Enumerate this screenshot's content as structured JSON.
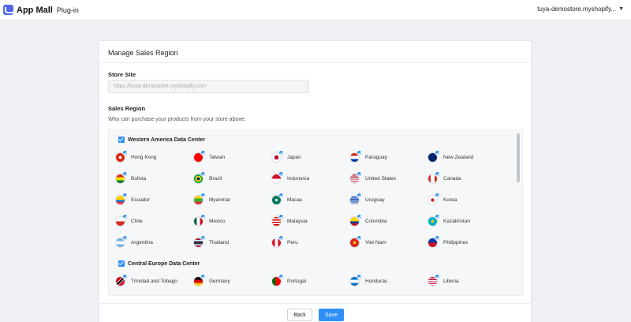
{
  "app": {
    "brand": "App Mall",
    "plugin_label": "Plug-in",
    "store_menu": "tuya-demostore.myshopify..."
  },
  "card": {
    "title": "Manage Sales Region",
    "store_site_label": "Store Site",
    "store_site_placeholder": "https://tuya-demostore.myshopify.com",
    "sales_region_label": "Sales Region",
    "sales_region_hint": "Who can purchase your products from your store above."
  },
  "groups": [
    {
      "title": "Western America Data Center",
      "checked": true,
      "countries": [
        {
          "name": "Hong Kong",
          "flag": "hk-flag"
        },
        {
          "name": "Taiwan",
          "flag": "tw-flag"
        },
        {
          "name": "Japan",
          "flag": "jp-flag"
        },
        {
          "name": "Paraguay",
          "flag": "py-flag"
        },
        {
          "name": "New Zealand",
          "flag": "nz-flag"
        },
        {
          "name": "Bolivia",
          "flag": "bo-flag"
        },
        {
          "name": "Brazil",
          "flag": "br-flag"
        },
        {
          "name": "Indonesia",
          "flag": "id-flag"
        },
        {
          "name": "United States",
          "flag": "us-flag"
        },
        {
          "name": "Canada",
          "flag": "ca-flag"
        },
        {
          "name": "Ecuador",
          "flag": "ec-flag"
        },
        {
          "name": "Myanmar",
          "flag": "mm-flag"
        },
        {
          "name": "Macau",
          "flag": "mo-flag"
        },
        {
          "name": "Uruguay",
          "flag": "uy-flag"
        },
        {
          "name": "Korea",
          "flag": "kr-flag"
        },
        {
          "name": "Chile",
          "flag": "cl-flag"
        },
        {
          "name": "Mexico",
          "flag": "mx-flag"
        },
        {
          "name": "Malaysia",
          "flag": "my-flag"
        },
        {
          "name": "Colombia",
          "flag": "co-flag"
        },
        {
          "name": "Kazakhstan",
          "flag": "kz-flag"
        },
        {
          "name": "Argentina",
          "flag": "ar-flag"
        },
        {
          "name": "Thailand",
          "flag": "th-flag"
        },
        {
          "name": "Peru",
          "flag": "pe-flag"
        },
        {
          "name": "Viet Nam",
          "flag": "vn-flag"
        },
        {
          "name": "Philippines",
          "flag": "ph-flag"
        }
      ]
    },
    {
      "title": "Central Europe Data Center",
      "checked": true,
      "countries": [
        {
          "name": "Trinidad and Tobago",
          "flag": "tt-flag"
        },
        {
          "name": "Germany",
          "flag": "de-flag"
        },
        {
          "name": "Portugal",
          "flag": "pt-flag"
        },
        {
          "name": "Honduras",
          "flag": "hn-flag"
        },
        {
          "name": "Liberia",
          "flag": "lr-flag"
        }
      ]
    }
  ],
  "buttons": {
    "back": "Back",
    "save": "Save"
  },
  "colors": {
    "accent": "#2f8ff7",
    "background": "#eef0f4",
    "brand": "#4f67f0"
  }
}
